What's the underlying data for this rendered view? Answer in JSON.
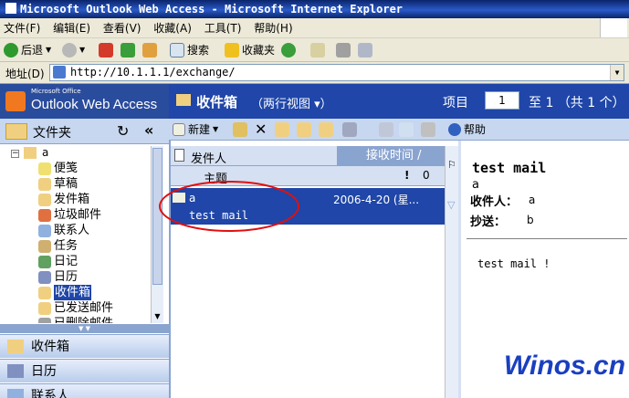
{
  "window": {
    "title": "Microsoft Outlook Web Access - Microsoft Internet Explorer"
  },
  "menubar": {
    "items": [
      "文件(F)",
      "编辑(E)",
      "查看(V)",
      "收藏(A)",
      "工具(T)",
      "帮助(H)"
    ]
  },
  "toolbar": {
    "back": "后退",
    "search": "搜索",
    "favorites": "收藏夹"
  },
  "address": {
    "label": "地址(D)",
    "url": "http://10.1.1.1/exchange/"
  },
  "brand": {
    "small": "Microsoft Office",
    "name": "Outlook Web Access"
  },
  "header": {
    "folder": "收件箱",
    "view": "（两行视图 ▾）",
    "item_label": "项目",
    "page": "1",
    "of_text": "至 1 （共 1 个）"
  },
  "folders": {
    "title": "文件夹",
    "root": "a",
    "items": [
      "便笺",
      "草稿",
      "发件箱",
      "垃圾邮件",
      "联系人",
      "任务",
      "日记",
      "日历",
      "收件箱",
      "已发送邮件",
      "已删除邮件"
    ],
    "selected_index": 8
  },
  "nav": {
    "inbox": "收件箱",
    "calendar": "日历",
    "contacts": "联系人"
  },
  "owa_toolbar": {
    "new": "新建",
    "help": "帮助"
  },
  "list": {
    "col_from": "发件人",
    "col_received": "接收时间",
    "col_subject": "主题",
    "col_importance": "!",
    "col_attach": "0"
  },
  "message": {
    "from": "a",
    "date": "2006-4-20 (星...",
    "subject": "test mail"
  },
  "preview": {
    "subject": "test mail",
    "from": "a",
    "to_label": "收件人：",
    "to": "a",
    "cc_label": "抄送：",
    "cc": "b",
    "body": "test mail !"
  },
  "watermark": "Winos.cn",
  "colors": {
    "accent": "#1f46a8",
    "annotation": "#e01010"
  }
}
